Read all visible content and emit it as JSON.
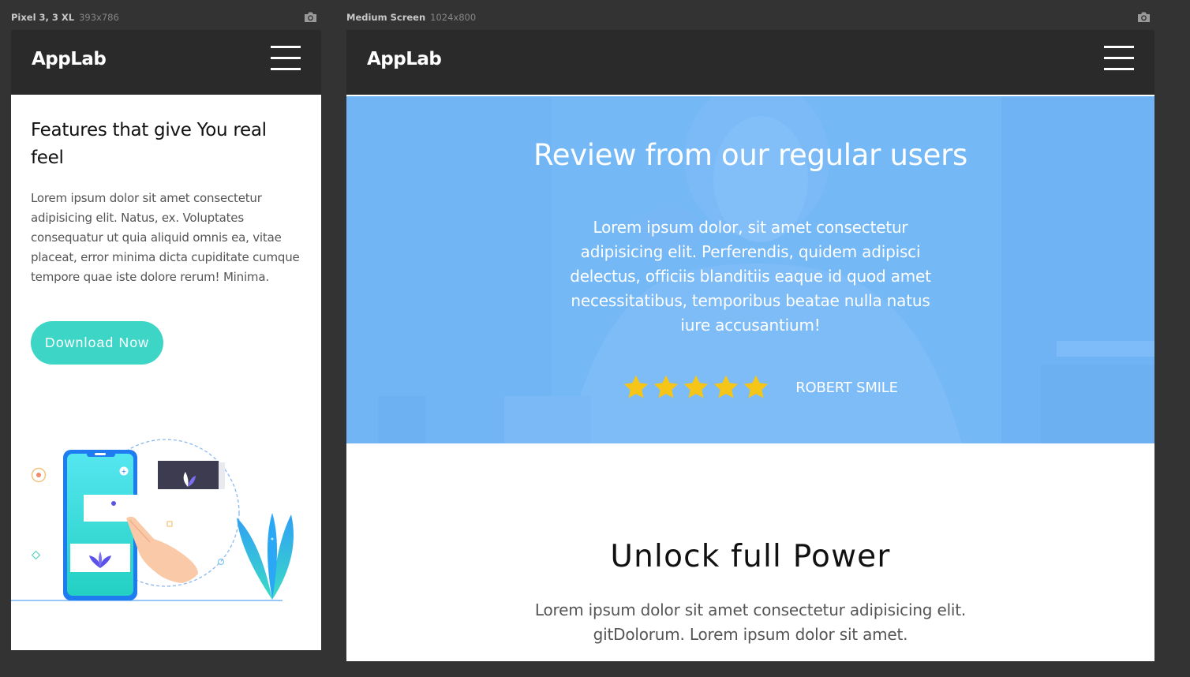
{
  "devices": {
    "phone": {
      "name": "Pixel 3, 3 XL",
      "dims": "393x786"
    },
    "medium": {
      "name": "Medium Screen",
      "dims": "1024x800"
    }
  },
  "brand": "AppLab",
  "phone_page": {
    "features_title": "Features that give You real feel",
    "features_text": "Lorem ipsum dolor sit amet consectetur adipisicing elit. Natus, ex. Voluptates consequatur ut quia aliquid omnis ea, vitae placeat, error minima dicta cupiditate cumque tempore quae iste dolore rerum! Minima.",
    "download_button": "Download Now"
  },
  "medium_page": {
    "review_title": "Review from our regular users",
    "review_quote": "Lorem ipsum dolor, sit amet consectetur adipisicing elit. Perferendis, quidem adipisci delectus, officiis blanditiis eaque id quod amet necessitatibus, temporibus beatae nulla natus iure accusantium!",
    "rating_stars": 5,
    "reviewer": "ROBERT SMILE",
    "unlock_title": "Unlock full Power",
    "unlock_text": "Lorem ipsum dolor sit amet consectetur adipisicing elit. gitDolorum. Lorem ipsum dolor sit amet."
  },
  "colors": {
    "navbar": "#2b2a2b",
    "accent_teal": "#3dd6c6",
    "hero_overlay": "#6eb4fa",
    "star": "#f5c518"
  },
  "icons": [
    "camera-icon",
    "hamburger-menu-icon",
    "star-icon"
  ]
}
